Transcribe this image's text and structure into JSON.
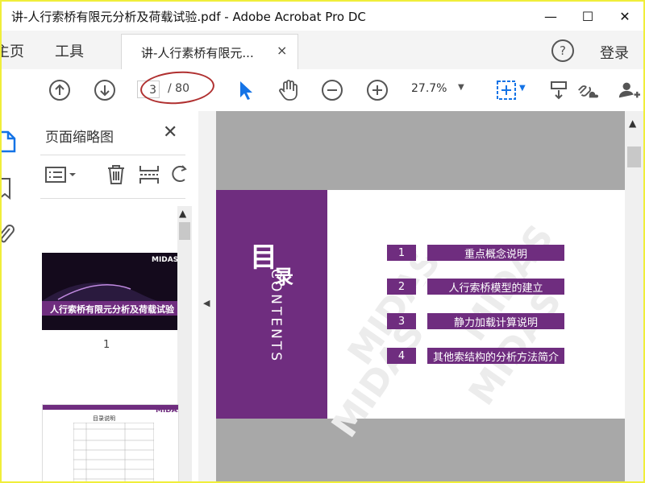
{
  "window": {
    "title": "讲-人行索桥有限元分析及荷载试验.pdf - Adobe Acrobat Pro DC",
    "controls": {
      "minimize": "—",
      "maximize": "☐",
      "close": "✕"
    }
  },
  "tabs": {
    "home": "主页",
    "tools": "工具",
    "document": "讲-人行素桥有限元...",
    "close": "×",
    "help": "?",
    "login": "登录"
  },
  "toolbar": {
    "page_current": "3",
    "page_total": "/ 80",
    "zoom": "27.7%",
    "zoom_caret": "▼"
  },
  "thumbnails": {
    "title": "页面缩略图",
    "close": "✕",
    "page1_label": "1",
    "page1_title": "人行索桥有限元分析及荷载试验",
    "page2_heading": "目录说明",
    "logo": "MIDAS"
  },
  "slide": {
    "heading_cn_1": "目",
    "heading_cn_2": "录",
    "heading_en": "CONTENTS",
    "watermark": "MIDAS",
    "toc": [
      {
        "num": "1",
        "text": "重点概念说明"
      },
      {
        "num": "2",
        "text": "人行索桥模型的建立"
      },
      {
        "num": "3",
        "text": "静力加载计算说明"
      },
      {
        "num": "4",
        "text": "其他索结构的分析方法简介"
      }
    ]
  },
  "colors": {
    "accent_purple": "#6f2d7f",
    "acrobat_blue": "#1473e6",
    "annotation_red": "#b03030",
    "frame_yellow": "#f0ee3a"
  },
  "icons": [
    "prev-page-icon",
    "next-page-icon",
    "select-arrow-icon",
    "hand-icon",
    "zoom-out-icon",
    "zoom-in-icon",
    "fit-page-icon",
    "annotate-icon",
    "share-link-icon",
    "add-user-icon",
    "thumbnails-icon",
    "bookmark-icon",
    "attachment-icon",
    "options-icon",
    "delete-icon",
    "insert-icon",
    "rotate-icon"
  ]
}
